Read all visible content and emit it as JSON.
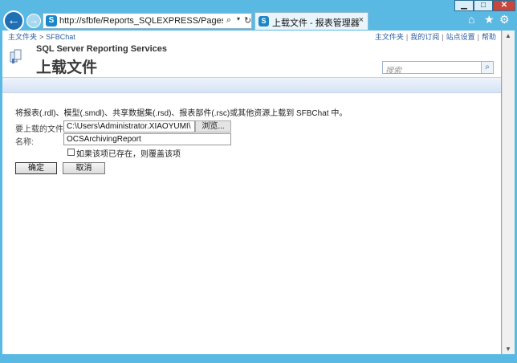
{
  "window": {
    "min_label": "▁",
    "max_label": "□",
    "close_label": "✕"
  },
  "nav": {
    "back_icon": "←",
    "forward_icon": "→",
    "address": "http://sfbfe/Reports_SQLEXPRESS/Pages/Import.as",
    "address_search_icon": "⌕",
    "address_dropdown_icon": "▾",
    "refresh_icon": "↻",
    "site_icon": "S",
    "tab_label": "上载文件 - 报表管理器",
    "tab_close": "×",
    "home_icon": "⌂",
    "favorites_icon": "★",
    "tools_icon": "⚙"
  },
  "header": {
    "breadcrumb_home": "主文件夹",
    "breadcrumb_sep": ">",
    "breadcrumb_current": "SFBChat",
    "top_links": [
      "主文件夹",
      "我的订阅",
      "站点设置",
      "帮助"
    ],
    "link_sep": "|",
    "app_name": "SQL Server Reporting Services",
    "page_title": "上载文件",
    "search_placeholder": "搜索",
    "search_icon": "⌕"
  },
  "form": {
    "description": "将报表(.rdl)、模型(.smdl)、共享数据集(.rsd)、报表部件(.rsc)或其他资源上载到 SFBChat 中。",
    "file_label": "要上载的文件:",
    "file_value": "C:\\Users\\Administrator.XIAOYUMI\\",
    "browse_label": "浏览...",
    "name_label": "名称:",
    "name_value": "OCSArchivingReport",
    "overwrite_label": "如果该项已存在，则覆盖该项",
    "ok_label": "确定",
    "cancel_label": "取消"
  },
  "scroll": {
    "up_icon": "▲",
    "down_icon": "▼"
  },
  "colors": {
    "frame": "#5ab9e3",
    "link": "#2a5d9f",
    "band": "#d6e3f5"
  }
}
